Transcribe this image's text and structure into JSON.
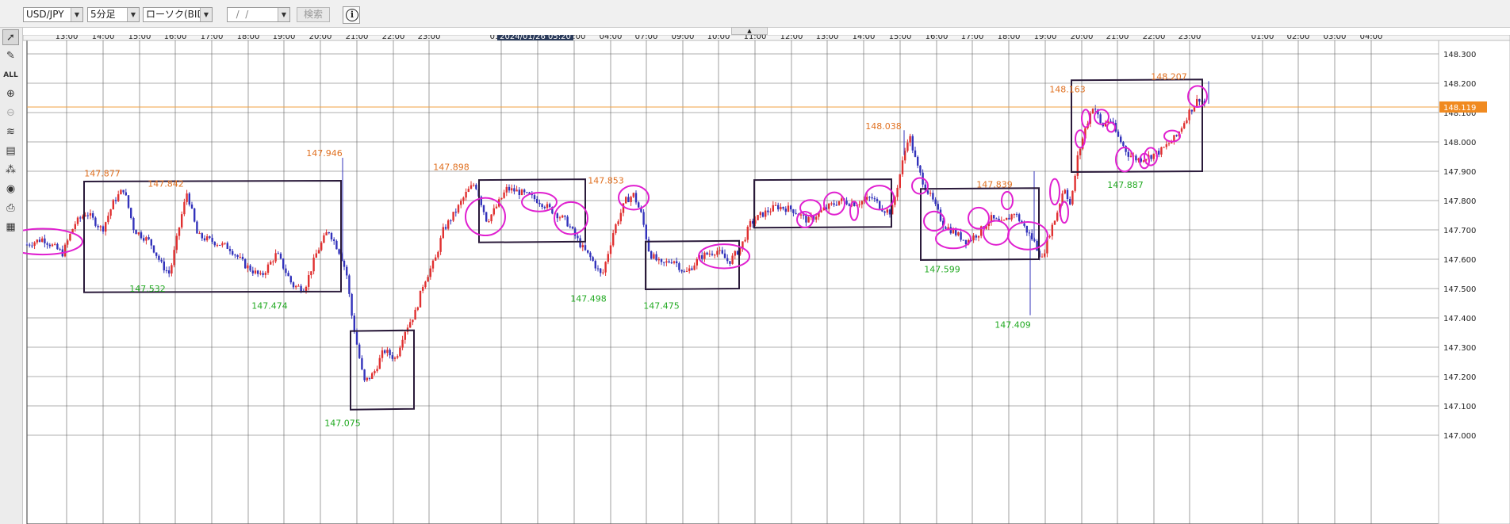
{
  "toolbar": {
    "pair": "USD/JPY",
    "timeframe": "5分足",
    "price_type": "ローソク(BID)",
    "date_placeholder": "  /  /  ",
    "search_label": "検索",
    "info_label": "i"
  },
  "left_tools": [
    "cursor-icon",
    "pen-icon",
    "delete-all-icon",
    "zoom-in-icon",
    "zoom-out-icon",
    "indicator-icon",
    "period-icon",
    "objects-icon",
    "eye-icon",
    "print-icon",
    "table-icon"
  ],
  "colors": {
    "up": "#e03030",
    "down": "#3333bb",
    "high_label": "#e07020",
    "low_label": "#22aa22",
    "price_line": "#f0a040",
    "box": "#2a1a3a",
    "circle": "#e020d0",
    "grid": "#606060"
  },
  "chart_data": {
    "type": "candlestick",
    "symbol": "USD/JPY",
    "interval": "5min",
    "x_ticks": [
      "13:00",
      "14:00",
      "15:00",
      "16:00",
      "17:00",
      "18:00",
      "19:00",
      "20:00",
      "21:00",
      "22:00",
      "23:00",
      "01:00",
      "02:00",
      "03:00",
      "04:00",
      "07:00",
      "09:00",
      "10:00",
      "11:00",
      "12:00",
      "13:00",
      "14:00",
      "15:00",
      "16:00",
      "17:00",
      "18:00",
      "19:00",
      "20:00",
      "21:00",
      "22:00",
      "23:00",
      "01:00",
      "02:00",
      "03:00",
      "04:00"
    ],
    "crosshair_time": "2024/01/26 05:20",
    "y_ticks": [
      "148.300",
      "148.200",
      "148.100",
      "148.000",
      "147.900",
      "147.800",
      "147.700",
      "147.600",
      "147.500",
      "147.400",
      "147.300",
      "147.200",
      "147.100",
      "147.000"
    ],
    "ylim": [
      147.0,
      148.32
    ],
    "current_price": "148.119",
    "high_labels": [
      {
        "text": "147.877",
        "value": 147.877
      },
      {
        "text": "147.842",
        "value": 147.842
      },
      {
        "text": "147.946",
        "value": 147.946
      },
      {
        "text": "147.898",
        "value": 147.898
      },
      {
        "text": "147.853",
        "value": 147.853
      },
      {
        "text": "148.038",
        "value": 148.038
      },
      {
        "text": "147.839",
        "value": 147.839
      },
      {
        "text": "148.163",
        "value": 148.163
      },
      {
        "text": "148.207",
        "value": 148.207
      }
    ],
    "low_labels": [
      {
        "text": "147.532",
        "value": 147.532
      },
      {
        "text": "147.474",
        "value": 147.474
      },
      {
        "text": "147.075",
        "value": 147.075
      },
      {
        "text": "147.498",
        "value": 147.498
      },
      {
        "text": "147.475",
        "value": 147.475
      },
      {
        "text": "147.599",
        "value": 147.599
      },
      {
        "text": "147.409",
        "value": 147.409
      },
      {
        "text": "147.887",
        "value": 147.887
      }
    ],
    "path": [
      [
        0,
        147.65
      ],
      [
        20,
        147.67
      ],
      [
        45,
        147.62
      ],
      [
        60,
        147.72
      ],
      [
        75,
        147.76
      ],
      [
        95,
        147.7
      ],
      [
        110,
        147.8
      ],
      [
        122,
        147.84
      ],
      [
        135,
        147.7
      ],
      [
        155,
        147.66
      ],
      [
        170,
        147.58
      ],
      [
        180,
        147.55
      ],
      [
        195,
        147.75
      ],
      [
        202,
        147.83
      ],
      [
        215,
        147.68
      ],
      [
        235,
        147.66
      ],
      [
        255,
        147.64
      ],
      [
        275,
        147.58
      ],
      [
        295,
        147.54
      ],
      [
        315,
        147.62
      ],
      [
        335,
        147.51
      ],
      [
        350,
        147.5
      ],
      [
        365,
        147.62
      ],
      [
        380,
        147.7
      ],
      [
        395,
        147.62
      ],
      [
        403,
        147.55
      ],
      [
        410,
        147.4
      ],
      [
        418,
        147.28
      ],
      [
        425,
        147.18
      ],
      [
        437,
        147.21
      ],
      [
        450,
        147.29
      ],
      [
        465,
        147.26
      ],
      [
        475,
        147.35
      ],
      [
        490,
        147.42
      ],
      [
        500,
        147.52
      ],
      [
        515,
        147.6
      ],
      [
        525,
        147.7
      ],
      [
        540,
        147.76
      ],
      [
        555,
        147.83
      ],
      [
        565,
        147.86
      ],
      [
        580,
        147.73
      ],
      [
        590,
        147.77
      ],
      [
        605,
        147.84
      ],
      [
        620,
        147.83
      ],
      [
        645,
        147.8
      ],
      [
        665,
        147.76
      ],
      [
        680,
        147.73
      ],
      [
        700,
        147.64
      ],
      [
        712,
        147.6
      ],
      [
        725,
        147.54
      ],
      [
        740,
        147.7
      ],
      [
        755,
        147.8
      ],
      [
        765,
        147.82
      ],
      [
        775,
        147.75
      ],
      [
        785,
        147.62
      ],
      [
        800,
        147.58
      ],
      [
        815,
        147.6
      ],
      [
        830,
        147.55
      ],
      [
        850,
        147.61
      ],
      [
        870,
        147.63
      ],
      [
        885,
        147.59
      ],
      [
        900,
        147.64
      ],
      [
        912,
        147.72
      ],
      [
        925,
        147.75
      ],
      [
        945,
        147.78
      ],
      [
        965,
        147.77
      ],
      [
        985,
        147.73
      ],
      [
        1005,
        147.77
      ],
      [
        1025,
        147.8
      ],
      [
        1045,
        147.79
      ],
      [
        1065,
        147.81
      ],
      [
        1080,
        147.77
      ],
      [
        1090,
        147.76
      ],
      [
        1100,
        147.88
      ],
      [
        1112,
        148.03
      ],
      [
        1122,
        147.92
      ],
      [
        1132,
        147.85
      ],
      [
        1142,
        147.8
      ],
      [
        1155,
        147.72
      ],
      [
        1170,
        147.69
      ],
      [
        1185,
        147.66
      ],
      [
        1200,
        147.69
      ],
      [
        1215,
        147.74
      ],
      [
        1230,
        147.72
      ],
      [
        1245,
        147.76
      ],
      [
        1260,
        147.7
      ],
      [
        1270,
        147.66
      ],
      [
        1280,
        147.6
      ],
      [
        1288,
        147.68
      ],
      [
        1298,
        147.75
      ],
      [
        1308,
        147.85
      ],
      [
        1316,
        147.78
      ],
      [
        1325,
        147.95
      ],
      [
        1335,
        148.05
      ],
      [
        1345,
        148.13
      ],
      [
        1355,
        148.05
      ],
      [
        1365,
        148.08
      ],
      [
        1375,
        148.02
      ],
      [
        1388,
        147.96
      ],
      [
        1400,
        147.94
      ],
      [
        1415,
        147.95
      ],
      [
        1430,
        147.97
      ],
      [
        1450,
        148.02
      ],
      [
        1465,
        148.1
      ],
      [
        1478,
        148.15
      ],
      [
        1485,
        148.13
      ]
    ],
    "boxes": [
      {
        "t1": 72,
        "t2": 396,
        "p1": 147.49,
        "p2": 147.865
      },
      {
        "t1": 408,
        "t2": 488,
        "p1": 147.09,
        "p2": 147.355
      },
      {
        "t1": 570,
        "t2": 704,
        "p1": 147.66,
        "p2": 147.87
      },
      {
        "t1": 780,
        "t2": 898,
        "p1": 147.5,
        "p2": 147.66
      },
      {
        "t1": 917,
        "t2": 1090,
        "p1": 147.71,
        "p2": 147.87
      },
      {
        "t1": 1127,
        "t2": 1276,
        "p1": 147.6,
        "p2": 147.84
      },
      {
        "t1": 1317,
        "t2": 1482,
        "p1": 147.9,
        "p2": 148.21
      }
    ],
    "ellipses": [
      {
        "t": 20,
        "p": 147.66,
        "rt": 50,
        "rp": 0.044
      },
      {
        "t": 578,
        "p": 147.745,
        "rt": 25,
        "rp": 0.064
      },
      {
        "t": 646,
        "p": 147.795,
        "rt": 22,
        "rp": 0.032
      },
      {
        "t": 686,
        "p": 147.74,
        "rt": 21,
        "rp": 0.055
      },
      {
        "t": 765,
        "p": 147.81,
        "rt": 19,
        "rp": 0.041
      },
      {
        "t": 879,
        "p": 147.61,
        "rt": 32,
        "rp": 0.041
      },
      {
        "t": 981,
        "p": 147.735,
        "rt": 10,
        "rp": 0.027
      },
      {
        "t": 988,
        "p": 147.775,
        "rt": 13,
        "rp": 0.027
      },
      {
        "t": 1018,
        "p": 147.79,
        "rt": 13,
        "rp": 0.038
      },
      {
        "t": 1043,
        "p": 147.765,
        "rt": 5,
        "rp": 0.032
      },
      {
        "t": 1075,
        "p": 147.81,
        "rt": 18,
        "rp": 0.041
      },
      {
        "t": 1126,
        "p": 147.85,
        "rt": 10,
        "rp": 0.027
      },
      {
        "t": 1144,
        "p": 147.73,
        "rt": 13,
        "rp": 0.033
      },
      {
        "t": 1168,
        "p": 147.67,
        "rt": 22,
        "rp": 0.033
      },
      {
        "t": 1200,
        "p": 147.74,
        "rt": 13,
        "rp": 0.036
      },
      {
        "t": 1222,
        "p": 147.69,
        "rt": 16,
        "rp": 0.041
      },
      {
        "t": 1236,
        "p": 147.8,
        "rt": 7,
        "rp": 0.03
      },
      {
        "t": 1262,
        "p": 147.68,
        "rt": 25,
        "rp": 0.047
      },
      {
        "t": 1296,
        "p": 147.83,
        "rt": 6,
        "rp": 0.044
      },
      {
        "t": 1308,
        "p": 147.76,
        "rt": 5,
        "rp": 0.036
      },
      {
        "t": 1328,
        "p": 148.01,
        "rt": 6,
        "rp": 0.03
      },
      {
        "t": 1335,
        "p": 148.08,
        "rt": 5,
        "rp": 0.03
      },
      {
        "t": 1355,
        "p": 148.085,
        "rt": 9,
        "rp": 0.025
      },
      {
        "t": 1367,
        "p": 148.05,
        "rt": 5,
        "rp": 0.016
      },
      {
        "t": 1384,
        "p": 147.94,
        "rt": 11,
        "rp": 0.041
      },
      {
        "t": 1409,
        "p": 147.935,
        "rt": 6,
        "rp": 0.025
      },
      {
        "t": 1417,
        "p": 147.95,
        "rt": 8,
        "rp": 0.03
      },
      {
        "t": 1444,
        "p": 148.02,
        "rt": 10,
        "rp": 0.019
      },
      {
        "t": 1476,
        "p": 148.155,
        "rt": 12,
        "rp": 0.036
      }
    ]
  }
}
